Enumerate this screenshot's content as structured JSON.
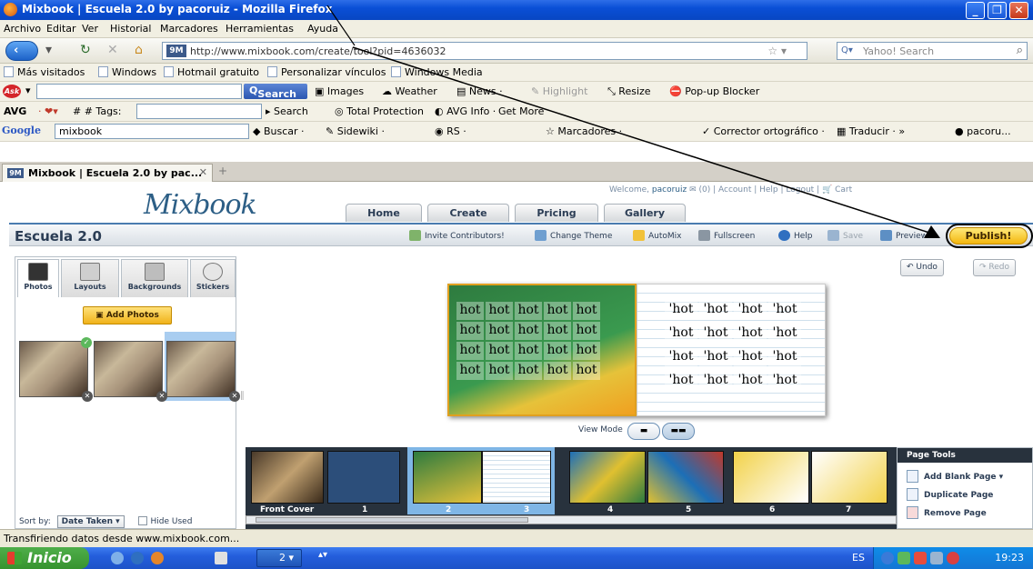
{
  "window": {
    "title": "Mixbook | Escuela 2.0 by pacoruiz - Mozilla Firefox",
    "min": "_",
    "max": "❐",
    "close": "✕"
  },
  "menu": [
    "Archivo",
    "Editar",
    "Ver",
    "Historial",
    "Marcadores",
    "Herramientas",
    "Ayuda"
  ],
  "nav": {
    "url": "http://www.mixbook.com/create/tool?pid=4636032",
    "site_icon_label": "9M",
    "search_placeholder": "Yahoo! Search"
  },
  "bookmarks": [
    "Más visitados",
    "Windows",
    "Hotmail gratuito",
    "Personalizar vínculos",
    "Windows Media"
  ],
  "ask_toolbar": {
    "search_button": "Search",
    "items": [
      "Images",
      "Weather",
      "News ·",
      "Highlight",
      "Resize",
      "Pop-up Blocker"
    ]
  },
  "avg_toolbar": {
    "brand": "AVG",
    "tags": "# # Tags:",
    "items": [
      "Search",
      "Total Protection",
      "AVG Info ·",
      "Get More"
    ]
  },
  "google_toolbar": {
    "brand": "Google",
    "query": "mixbook",
    "items": [
      "Buscar ·",
      "Sidewiki ·",
      "RS ·",
      "Marcadores ·",
      "Corrector ortográfico ·",
      "Traducir · »",
      "pacoru..."
    ]
  },
  "tab": {
    "label": "Mixbook | Escuela 2.0 by pac...",
    "icon_label": "9M",
    "new_tab": "+"
  },
  "mixbook": {
    "logo": "Mixbook",
    "welcome": {
      "prefix": "Welcome,",
      "user": "pacoruiz",
      "inbox": "(0)",
      "links": "| Account | Help | Logout |",
      "cart": "Cart"
    },
    "main_nav": [
      "Home",
      "Create",
      "Pricing",
      "Gallery"
    ],
    "project_title": "Escuela 2.0",
    "header_buttons": {
      "invite": "Invite Contributors!",
      "theme": "Change Theme",
      "automix": "AutoMix",
      "fullscreen": "Fullscreen",
      "help": "Help",
      "save": "Save",
      "preview": "Preview",
      "publish": "Publish!"
    },
    "panel_tabs": [
      "Photos",
      "Layouts",
      "Backgrounds",
      "Stickers"
    ],
    "add_photos": "Add Photos",
    "sort": {
      "label": "Sort by:",
      "value": "Date Taken",
      "hide_used": "Hide Used"
    },
    "undo": "Undo",
    "redo": "Redo",
    "hot_word": "hot",
    "hot_word_right": "'hot",
    "view_mode": "View Mode",
    "filmstrip": {
      "labels": [
        "Front Cover",
        "1",
        "2",
        "3",
        "4",
        "5",
        "6",
        "7"
      ]
    },
    "page_tools": {
      "title": "Page Tools",
      "items": [
        "Add Blank Page",
        "Duplicate Page",
        "Remove Page"
      ]
    }
  },
  "status": "Transfiriendo datos desde www.mixbook.com...",
  "taskbar": {
    "start": "Inicio",
    "task_label": "2 ▾",
    "lang": "ES",
    "clock": "19:23"
  }
}
